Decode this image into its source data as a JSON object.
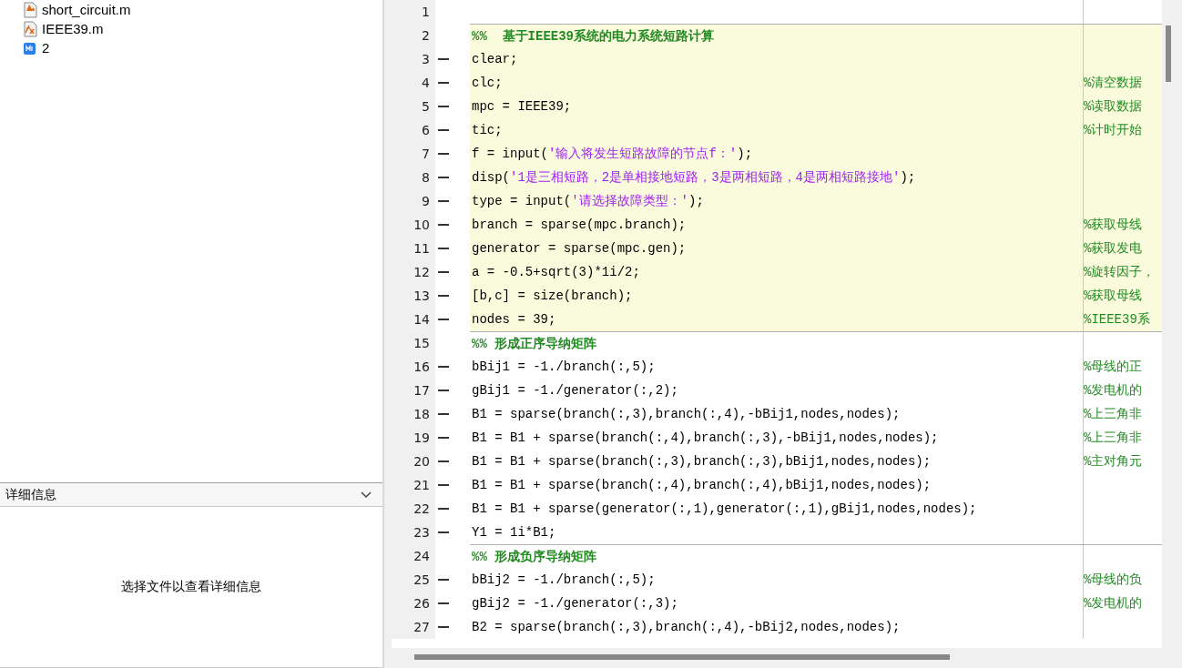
{
  "file_list": [
    {
      "name": "short_circuit.m",
      "kind": "script"
    },
    {
      "name": "IEEE39.m",
      "kind": "function"
    },
    {
      "name": "2",
      "kind": "document"
    }
  ],
  "details": {
    "title": "详细信息",
    "expanded": true,
    "message": "选择文件以查看详细信息"
  },
  "editor": {
    "lines": [
      {
        "number": "1",
        "kind": "blank",
        "runnable": false,
        "highlighted": false
      },
      {
        "number": "2",
        "kind": "cell_title",
        "runnable": false,
        "highlighted": true,
        "segments": [
          {
            "kind": "cell_title",
            "text": "%%  基于IEEE39系统的电力系统短路计算"
          }
        ]
      },
      {
        "number": "3",
        "kind": "code",
        "runnable": true,
        "highlighted": true,
        "segments": [
          {
            "kind": "plain",
            "text": "clear;"
          }
        ]
      },
      {
        "number": "4",
        "kind": "code",
        "runnable": true,
        "highlighted": true,
        "segments": [
          {
            "kind": "plain",
            "text": "clc;"
          }
        ],
        "comment": "%清空数据"
      },
      {
        "number": "5",
        "kind": "code",
        "runnable": true,
        "highlighted": true,
        "segments": [
          {
            "kind": "plain",
            "text": "mpc = IEEE39;"
          }
        ],
        "comment": "%读取数据"
      },
      {
        "number": "6",
        "kind": "code",
        "runnable": true,
        "highlighted": true,
        "segments": [
          {
            "kind": "plain",
            "text": "tic;"
          }
        ],
        "comment": "%计时开始"
      },
      {
        "number": "7",
        "kind": "code",
        "runnable": true,
        "highlighted": true,
        "segments": [
          {
            "kind": "plain",
            "text": "f = input("
          },
          {
            "kind": "string",
            "text": "'输入将发生短路故障的节点f：'"
          },
          {
            "kind": "plain",
            "text": ");"
          }
        ]
      },
      {
        "number": "8",
        "kind": "code",
        "runnable": true,
        "highlighted": true,
        "segments": [
          {
            "kind": "plain",
            "text": "disp("
          },
          {
            "kind": "string",
            "text": "'1是三相短路，2是单相接地短路，3是两相短路，4是两相短路接地'"
          },
          {
            "kind": "plain",
            "text": ");"
          }
        ]
      },
      {
        "number": "9",
        "kind": "code",
        "runnable": true,
        "highlighted": true,
        "segments": [
          {
            "kind": "plain",
            "text": "type = input("
          },
          {
            "kind": "string",
            "text": "'请选择故障类型：'"
          },
          {
            "kind": "plain",
            "text": ");"
          }
        ]
      },
      {
        "number": "10",
        "kind": "code",
        "runnable": true,
        "highlighted": true,
        "segments": [
          {
            "kind": "plain",
            "text": "branch = sparse(mpc.branch);"
          }
        ],
        "comment": "%获取母线"
      },
      {
        "number": "11",
        "kind": "code",
        "runnable": true,
        "highlighted": true,
        "segments": [
          {
            "kind": "plain",
            "text": "generator = sparse(mpc.gen);"
          }
        ],
        "comment": "%获取发电"
      },
      {
        "number": "12",
        "kind": "code",
        "runnable": true,
        "highlighted": true,
        "segments": [
          {
            "kind": "plain",
            "text": "a = -0.5+sqrt(3)*1i/2;"
          }
        ],
        "comment": "%旋转因子，"
      },
      {
        "number": "13",
        "kind": "code",
        "runnable": true,
        "highlighted": true,
        "segments": [
          {
            "kind": "plain",
            "text": "[b,c] = size(branch);"
          }
        ],
        "comment": "%获取母线"
      },
      {
        "number": "14",
        "kind": "code",
        "runnable": true,
        "highlighted": true,
        "segments": [
          {
            "kind": "plain",
            "text": "nodes = 39;"
          }
        ],
        "comment": "%IEEE39系"
      },
      {
        "number": "15",
        "kind": "cell_title",
        "runnable": false,
        "highlighted": false,
        "segments": [
          {
            "kind": "cell_title",
            "text": "%% 形成正序导纳矩阵"
          }
        ]
      },
      {
        "number": "16",
        "kind": "code",
        "runnable": true,
        "highlighted": false,
        "segments": [
          {
            "kind": "plain",
            "text": "bBij1 = -1./branch(:,5);"
          }
        ],
        "comment": "%母线的正"
      },
      {
        "number": "17",
        "kind": "code",
        "runnable": true,
        "highlighted": false,
        "segments": [
          {
            "kind": "plain",
            "text": "gBij1 = -1./generator(:,2);"
          }
        ],
        "comment": "%发电机的"
      },
      {
        "number": "18",
        "kind": "code",
        "runnable": true,
        "highlighted": false,
        "segments": [
          {
            "kind": "plain",
            "text": "B1 = sparse(branch(:,3),branch(:,4),-bBij1,nodes,nodes);"
          }
        ],
        "comment": "%上三角非"
      },
      {
        "number": "19",
        "kind": "code",
        "runnable": true,
        "highlighted": false,
        "segments": [
          {
            "kind": "plain",
            "text": "B1 = B1 + sparse(branch(:,4),branch(:,3),-bBij1,nodes,nodes);"
          }
        ],
        "comment": "%上三角非"
      },
      {
        "number": "20",
        "kind": "code",
        "runnable": true,
        "highlighted": false,
        "segments": [
          {
            "kind": "plain",
            "text": "B1 = B1 + sparse(branch(:,3),branch(:,3),bBij1,nodes,nodes);"
          }
        ],
        "comment": "%主对角元"
      },
      {
        "number": "21",
        "kind": "code",
        "runnable": true,
        "highlighted": false,
        "segments": [
          {
            "kind": "plain",
            "text": "B1 = B1 + sparse(branch(:,4),branch(:,4),bBij1,nodes,nodes);"
          }
        ]
      },
      {
        "number": "22",
        "kind": "code",
        "runnable": true,
        "highlighted": false,
        "segments": [
          {
            "kind": "plain",
            "text": "B1 = B1 + sparse(generator(:,1),generator(:,1),gBij1,nodes,nodes);"
          }
        ]
      },
      {
        "number": "23",
        "kind": "code",
        "runnable": true,
        "highlighted": false,
        "segments": [
          {
            "kind": "plain",
            "text": "Y1 = 1i*B1;"
          }
        ]
      },
      {
        "number": "24",
        "kind": "cell_title",
        "runnable": false,
        "highlighted": false,
        "segments": [
          {
            "kind": "cell_title",
            "text": "%% 形成负序导纳矩阵"
          }
        ]
      },
      {
        "number": "25",
        "kind": "code",
        "runnable": true,
        "highlighted": false,
        "segments": [
          {
            "kind": "plain",
            "text": "bBij2 = -1./branch(:,5);"
          }
        ],
        "comment": "%母线的负"
      },
      {
        "number": "26",
        "kind": "code",
        "runnable": true,
        "highlighted": false,
        "segments": [
          {
            "kind": "plain",
            "text": "gBij2 = -1./generator(:,3);"
          }
        ],
        "comment": "%发电机的"
      },
      {
        "number": "27",
        "kind": "code",
        "runnable": true,
        "highlighted": false,
        "segments": [
          {
            "kind": "plain",
            "text": "B2 = sparse(branch(:,3),branch(:,4),-bBij2,nodes,nodes);"
          }
        ]
      }
    ]
  }
}
